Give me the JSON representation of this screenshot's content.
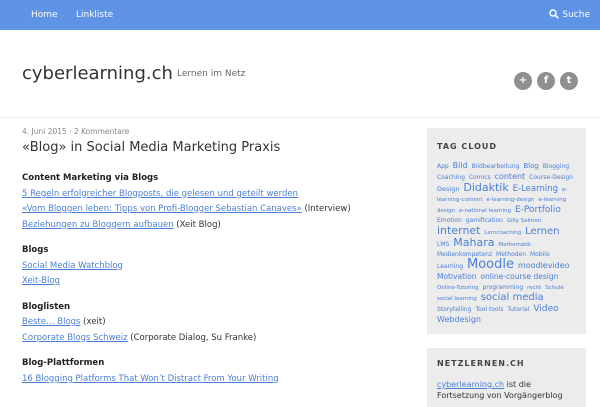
{
  "nav": {
    "items": [
      {
        "label": "Home"
      },
      {
        "label": "Linkliste"
      }
    ],
    "search_label": "Suche"
  },
  "site": {
    "title": "cyberlearning.ch",
    "tagline": "Lernen im Netz"
  },
  "social": [
    {
      "icon": "plus-icon",
      "glyph": "+"
    },
    {
      "icon": "facebook-icon",
      "glyph": "f"
    },
    {
      "icon": "twitter-icon",
      "glyph": "t"
    }
  ],
  "post": {
    "date": "4. Juni 2015",
    "comments": "2 Kommentare",
    "title": "«Blog» in Social Media Marketing Praxis",
    "sections": [
      {
        "heading": "Content Marketing via Blogs",
        "lines": [
          {
            "link": "5 Regeln erfolgreicher Blogposts, die gelesen und geteilt werden",
            "suffix": ""
          },
          {
            "link": "«Vom Bloggen leben: Tipps von Profi-Blogger Sebastian Canaves»",
            "suffix": " (Interview)"
          },
          {
            "link": "Beziehungen zu Bloggern aufbauen",
            "suffix": " (Xeit Blog)"
          }
        ]
      },
      {
        "heading": "Blogs",
        "lines": [
          {
            "link": "Social Media Watchblog",
            "suffix": ""
          },
          {
            "link": "Xeit-Blog",
            "suffix": ""
          }
        ]
      },
      {
        "heading": "Bloglisten",
        "lines": [
          {
            "link": "Beste… Blogs",
            "suffix": " (xeit)"
          },
          {
            "link": "Corporate Blogs Schweiz",
            "suffix": " (Corporate Dialog, Su Franke)"
          }
        ]
      },
      {
        "heading": "Blog-Plattformen",
        "lines": [
          {
            "link": "16 Blogging Platforms That Won’t Distract From Your Writing",
            "suffix": ""
          }
        ]
      }
    ]
  },
  "sidebar": {
    "tagcloud_title": "TAG CLOUD",
    "tags": [
      {
        "t": "App",
        "s": 6
      },
      {
        "t": "Bild",
        "s": 8
      },
      {
        "t": "Bildbearbeitung",
        "s": 6
      },
      {
        "t": "Blog",
        "s": 7
      },
      {
        "t": "Blogging",
        "s": 6
      },
      {
        "t": "Coaching",
        "s": 6
      },
      {
        "t": "Comics",
        "s": 6
      },
      {
        "t": "content",
        "s": 8
      },
      {
        "t": "Course-Design",
        "s": 6
      },
      {
        "t": "Design",
        "s": 6.5
      },
      {
        "t": "Didaktik",
        "s": 11
      },
      {
        "t": "E-Learning",
        "s": 8.5
      },
      {
        "t": "e-learning-content",
        "s": 5.5
      },
      {
        "t": "e-learning-design",
        "s": 5.5
      },
      {
        "t": "e-learning",
        "s": 5.5
      },
      {
        "t": "design",
        "s": 5.5
      },
      {
        "t": "e-national learning",
        "s": 5.5
      },
      {
        "t": "E-Portfolio",
        "s": 9
      },
      {
        "t": "Emotion",
        "s": 6
      },
      {
        "t": "gamification",
        "s": 6
      },
      {
        "t": "Gilly Salmon",
        "s": 5.5
      },
      {
        "t": "internet",
        "s": 11
      },
      {
        "t": "Lerncoaching",
        "s": 5.5
      },
      {
        "t": "Lernen",
        "s": 10
      },
      {
        "t": "LMS",
        "s": 6
      },
      {
        "t": "Mahara",
        "s": 11
      },
      {
        "t": "Mathematik",
        "s": 5.5
      },
      {
        "t": "Medienkompetenz",
        "s": 6
      },
      {
        "t": "Methoden",
        "s": 6
      },
      {
        "t": "Mobile Learning",
        "s": 6
      },
      {
        "t": "Moodle",
        "s": 13
      },
      {
        "t": "moodlevideo",
        "s": 8
      },
      {
        "t": "Motivation",
        "s": 7.5
      },
      {
        "t": "online-course design",
        "s": 7.5
      },
      {
        "t": "Online-Tutoring",
        "s": 5.5
      },
      {
        "t": "programming",
        "s": 6
      },
      {
        "t": "recht",
        "s": 5.5
      },
      {
        "t": "Schule",
        "s": 5.5
      },
      {
        "t": "social learning",
        "s": 5.5
      },
      {
        "t": "social media",
        "s": 10
      },
      {
        "t": "Storytelling",
        "s": 6
      },
      {
        "t": "Tool tools",
        "s": 6
      },
      {
        "t": "Tutorial",
        "s": 6
      },
      {
        "t": "Video",
        "s": 9
      },
      {
        "t": "Webdesign",
        "s": 8
      }
    ],
    "netz_title": "NETZLERNEN.CH",
    "netz_link": "cyberlearning.ch",
    "netz_text": " ist die Fortsetzung von Vorgängerblog"
  },
  "colors": {
    "nav_bg": "#5e93e6",
    "link": "#4a7fd6",
    "sidebar_bg": "#ececec"
  }
}
